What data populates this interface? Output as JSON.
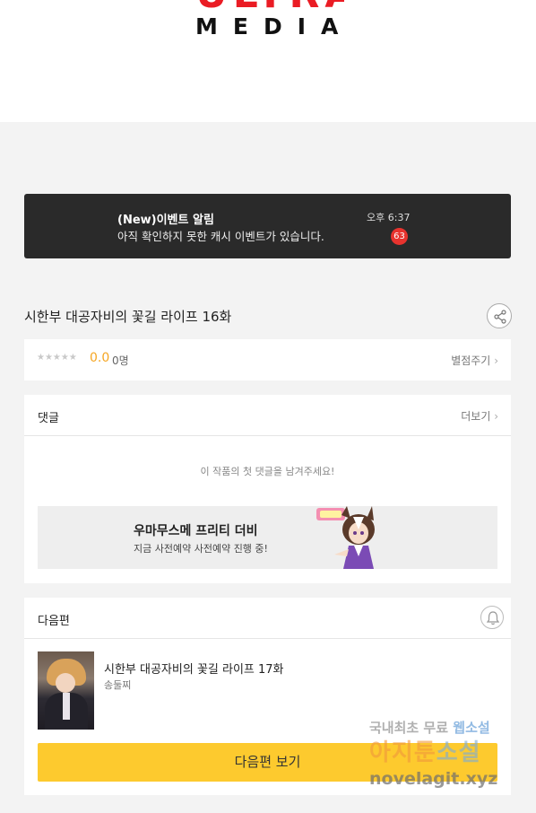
{
  "brand": {
    "logo_top": "ULTRA",
    "logo_bottom": "MEDIA"
  },
  "notice": {
    "title": "(New)이벤트 알림",
    "body": "아직 확인하지 못한 캐시 이벤트가 있습니다.",
    "time": "오후 6:37",
    "badge_count": "63"
  },
  "episode": {
    "title": "시한부 대공자비의 꽃길 라이프 16화"
  },
  "rating": {
    "stars": "★★★★★",
    "score": "0.0",
    "count": "0명",
    "rate_link": "별점주기"
  },
  "comments": {
    "label": "댓글",
    "more": "더보기",
    "empty_message": "이 작품의 첫 댓글을 남겨주세요!",
    "ad": {
      "title": "우마무스메 프리티 더비",
      "subtitle": "지금 사전예약 사전예약 진행 중!"
    }
  },
  "next_episode": {
    "label": "다음편",
    "title": "시한부 대공자비의 꽃길 라이프 17화",
    "author": "송둘찌",
    "button": "다음편 보기"
  },
  "watermark": {
    "line1_a": "국내최초 무료",
    "line1_b": "웹소설",
    "line2_a": "아지툰",
    "line2_b": "소설",
    "line3": "novelagit.xyz"
  },
  "colors": {
    "accent_yellow": "#fdca2e",
    "badge_red": "#e8332e",
    "score_orange": "#f5a623",
    "notice_bg": "#2a2a2a"
  }
}
